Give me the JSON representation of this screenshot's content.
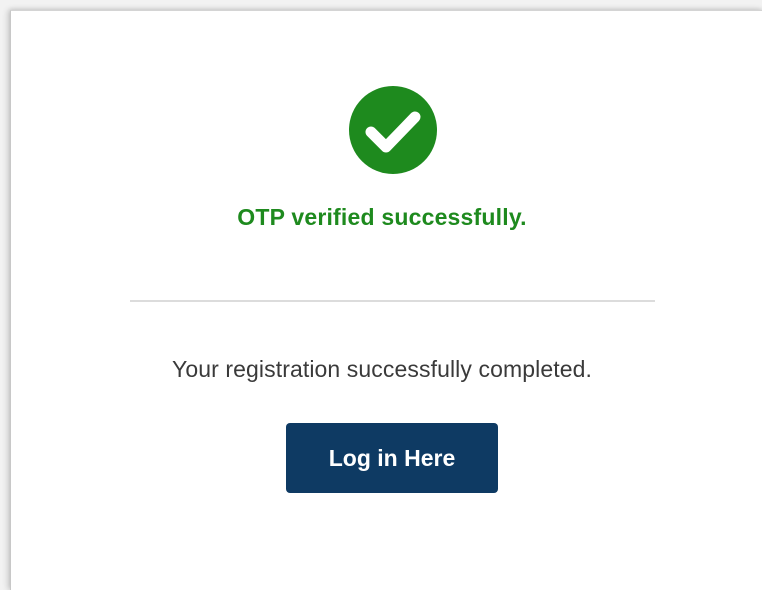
{
  "status": {
    "icon": "check-circle-icon",
    "message": "OTP verified successfully.",
    "color": "#1e8a1e"
  },
  "registration": {
    "message": "Your registration successfully completed."
  },
  "actions": {
    "login_label": "Log in Here",
    "button_color": "#0e3a63"
  }
}
